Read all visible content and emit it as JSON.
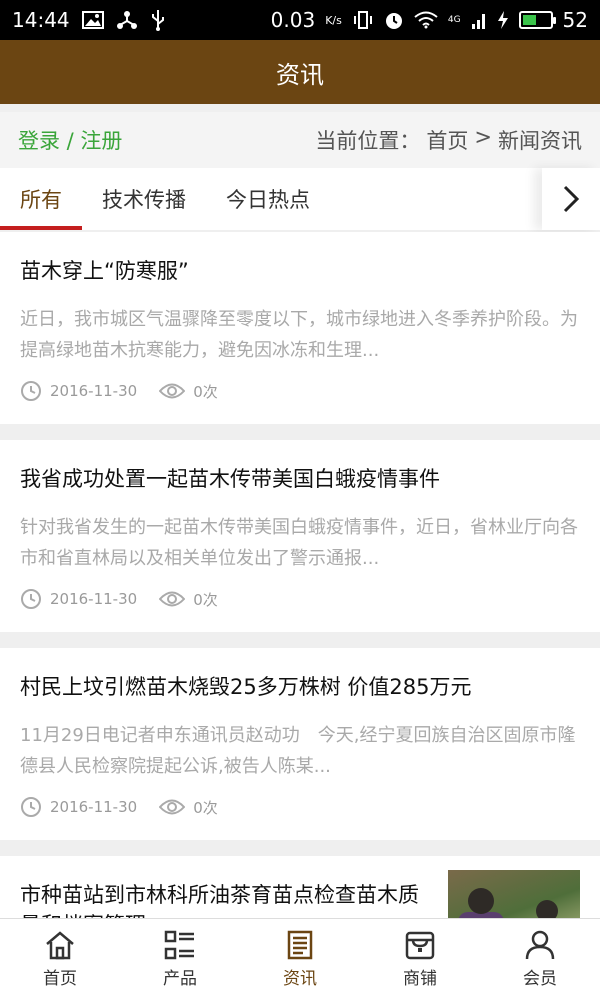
{
  "status_bar": {
    "time": "14:44",
    "speed": "0.03",
    "speed_unit": "K/s",
    "battery": "52",
    "battery_level": 0.52,
    "network": "4G"
  },
  "header": {
    "title": "资讯"
  },
  "location": {
    "login": "登录 / 注册",
    "prefix": "当前位置：",
    "home": "首页",
    "separator": ">",
    "current": "新闻资讯"
  },
  "tabs": [
    {
      "label": "所有",
      "active": true
    },
    {
      "label": "技术传播",
      "active": false
    },
    {
      "label": "今日热点",
      "active": false
    }
  ],
  "articles": [
    {
      "title": "苗木穿上“防寒服”",
      "summary": "近日，我市城区气温骤降至零度以下，城市绿地进入冬季养护阶段。为提高绿地苗木抗寒能力，避免因冰冻和生理...",
      "date": "2016-11-30",
      "views": "0次"
    },
    {
      "title": "我省成功处置一起苗木传带美国白蛾疫情事件",
      "summary": "针对我省发生的一起苗木传带美国白蛾疫情事件，近日，省林业厅向各市和省直林局以及相关单位发出了警示通报...",
      "date": "2016-11-30",
      "views": "0次"
    },
    {
      "title": "村民上坟引燃苗木烧毁25多万株树 价值285万元",
      "summary": "11月29日电记者申东通讯员赵动功　今天,经宁夏回族自治区固原市隆德县人民检察院提起公诉,被告人陈某...",
      "date": "2016-11-30",
      "views": "0次"
    },
    {
      "title": "市种苗站到市林科所油茶育苗点检查苗木质量和档案管理"
    }
  ],
  "nav": [
    {
      "label": "首页",
      "icon": "home-icon",
      "active": false
    },
    {
      "label": "产品",
      "icon": "product-grid-icon",
      "active": false
    },
    {
      "label": "资讯",
      "icon": "news-icon",
      "active": true
    },
    {
      "label": "商铺",
      "icon": "store-icon",
      "active": false
    },
    {
      "label": "会员",
      "icon": "member-icon",
      "active": false
    }
  ],
  "colors": {
    "header": "#6b4512",
    "tab_indicator": "#c41e1e",
    "login_link": "#3aa53a",
    "active_nav": "#6b4512"
  }
}
